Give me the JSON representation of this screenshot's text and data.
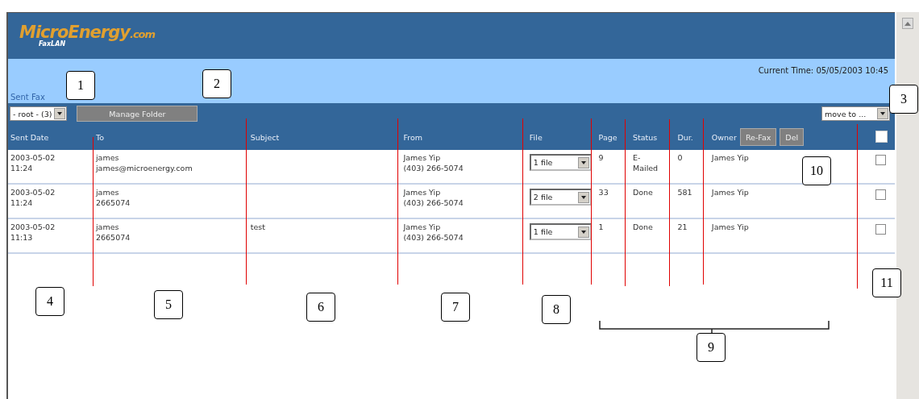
{
  "logo": {
    "brand": "MicroEnergy",
    "suffix": ".com",
    "product": "FaxLAN"
  },
  "current_time": "Current Time: 05/05/2003 10:45",
  "folder_title": "Sent Fax",
  "toolbar": {
    "folder_select": "- root - (3)",
    "manage_button": "Manage Folder",
    "move_select": "move to ..."
  },
  "table": {
    "columns": [
      "Sent Date",
      "To",
      "Subject",
      "From",
      "File",
      "Page",
      "Status",
      "Dur.",
      "Owner"
    ],
    "header_buttons": [
      "Re-Fax",
      "Del"
    ],
    "select_all_checked": false,
    "rows": [
      {
        "date": "2003-05-02",
        "time": "11:24",
        "to_name": "james",
        "to_address": "james@microenergy.com",
        "subject": "",
        "from_name": "James Yip",
        "from_phone": "(403) 266-5074",
        "file": "1 file",
        "page": "9",
        "status": "E-Mailed",
        "duration": "0",
        "owner": "James Yip",
        "checked": false
      },
      {
        "date": "2003-05-02",
        "time": "11:24",
        "to_name": "james",
        "to_address": "2665074",
        "subject": "",
        "from_name": "James Yip",
        "from_phone": "(403) 266-5074",
        "file": "2 file",
        "page": "33",
        "status": "Done",
        "duration": "581",
        "owner": "James Yip",
        "checked": false
      },
      {
        "date": "2003-05-02",
        "time": "11:13",
        "to_name": "james",
        "to_address": "2665074",
        "subject": "test",
        "from_name": "James Yip",
        "from_phone": "(403) 266-5074",
        "file": "1 file",
        "page": "1",
        "status": "Done",
        "duration": "21",
        "owner": "James Yip",
        "checked": false
      }
    ]
  },
  "callouts": [
    "1",
    "2",
    "3",
    "4",
    "5",
    "6",
    "7",
    "8",
    "9",
    "10",
    "11"
  ]
}
